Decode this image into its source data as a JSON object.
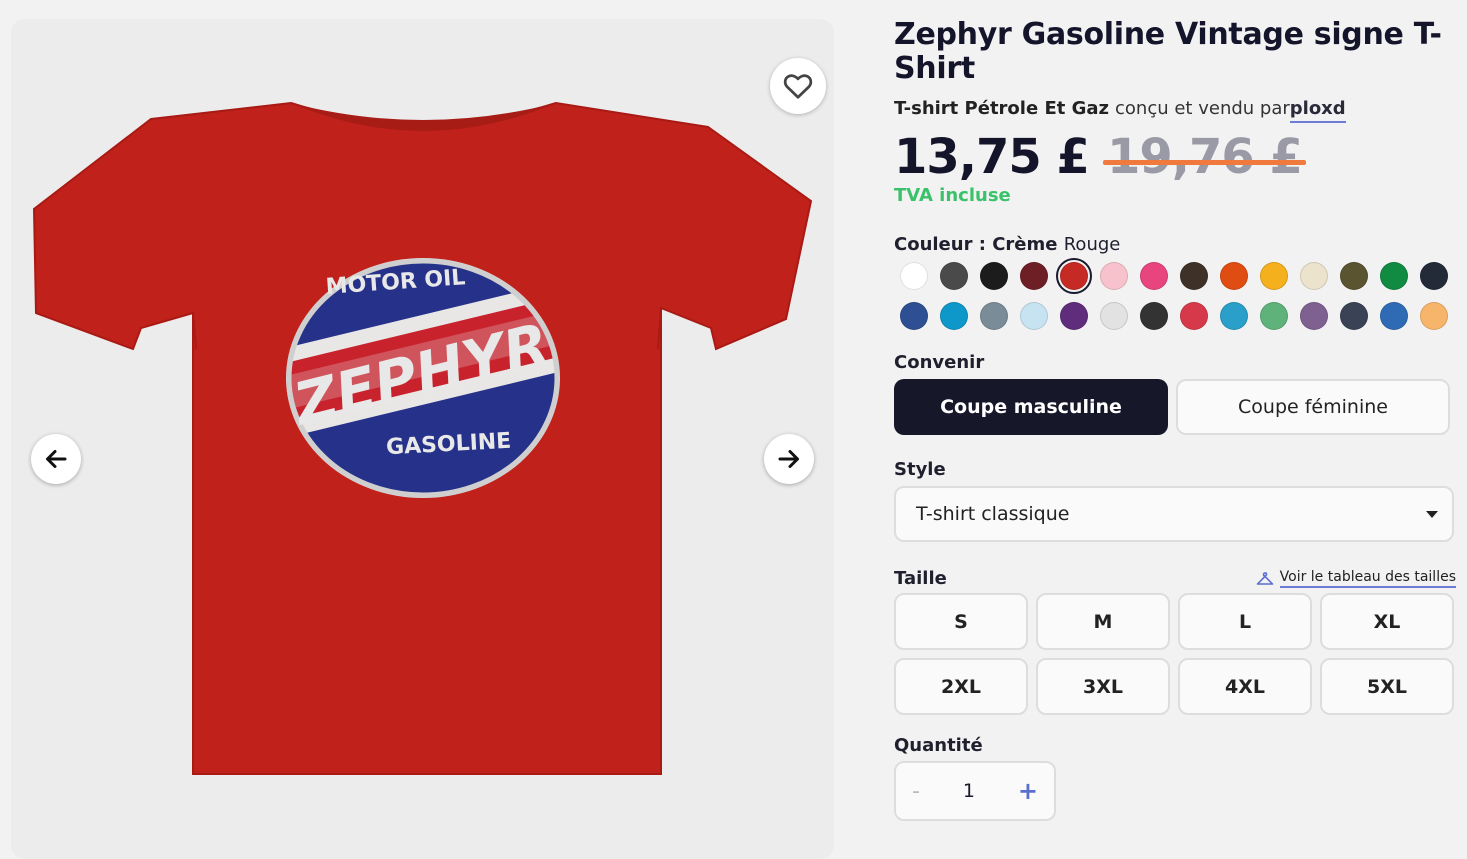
{
  "product": {
    "title": "Zephyr Gasoline Vintage signe T-Shirt",
    "category": "T-shirt Pétrole Et Gaz",
    "designed_by_text": "conçu et vendu par",
    "designer": "ploxd",
    "price": "13,75 £",
    "old_price": "19,76 £",
    "vat": "TVA incluse",
    "image_text": {
      "top": "MOTOR OIL",
      "middle": "ZEPHYR",
      "bottom": "GASOLINE"
    }
  },
  "colour": {
    "label": "Couleur : Crème",
    "selected": "Rouge",
    "swatches": [
      {
        "color": "#ffffff",
        "selected": false
      },
      {
        "color": "#4a4a4a",
        "selected": false
      },
      {
        "color": "#1c1c1c",
        "selected": false
      },
      {
        "color": "#6e1f26",
        "selected": false
      },
      {
        "color": "#c62a24",
        "selected": true
      },
      {
        "color": "#f8c2cc",
        "selected": false
      },
      {
        "color": "#e8457e",
        "selected": false
      },
      {
        "color": "#3d3128",
        "selected": false
      },
      {
        "color": "#e04d12",
        "selected": false
      },
      {
        "color": "#f4b01d",
        "selected": false
      },
      {
        "color": "#ebe3cc",
        "selected": false
      },
      {
        "color": "#5b5431",
        "selected": false
      },
      {
        "color": "#118a42",
        "selected": false
      },
      {
        "color": "#232a38",
        "selected": false
      },
      {
        "color": "#2f4f94",
        "selected": false
      },
      {
        "color": "#0e98c9",
        "selected": false
      },
      {
        "color": "#7b8c99",
        "selected": false
      },
      {
        "color": "#c7e3f2",
        "selected": false
      },
      {
        "color": "#5f2d7b",
        "selected": false
      },
      {
        "color": "#e2e2e2",
        "selected": false
      },
      {
        "color": "#333333",
        "selected": false
      },
      {
        "color": "#d63a4a",
        "selected": false
      },
      {
        "color": "#2a9fc9",
        "selected": false
      },
      {
        "color": "#5fb27a",
        "selected": false
      },
      {
        "color": "#7e6191",
        "selected": false
      },
      {
        "color": "#3a4255",
        "selected": false
      },
      {
        "color": "#2f6bb5",
        "selected": false
      },
      {
        "color": "#f6b56b",
        "selected": false
      }
    ]
  },
  "fit": {
    "label": "Convenir",
    "options": [
      "Coupe masculine",
      "Coupe féminine"
    ],
    "selected": "Coupe masculine"
  },
  "style": {
    "label": "Style",
    "value": "T-shirt classique"
  },
  "size": {
    "label": "Taille",
    "guide": "Voir le tableau des tailles",
    "options": [
      "S",
      "M",
      "L",
      "XL",
      "2XL",
      "3XL",
      "4XL",
      "5XL"
    ]
  },
  "quantity": {
    "label": "Quantité",
    "value": "1",
    "minus": "-",
    "plus": "+"
  },
  "icons": {
    "favorite": "heart-icon",
    "prev": "arrow-left-icon",
    "next": "arrow-right-icon",
    "size_guide": "hanger-icon",
    "dropdown": "caret-down-icon"
  }
}
